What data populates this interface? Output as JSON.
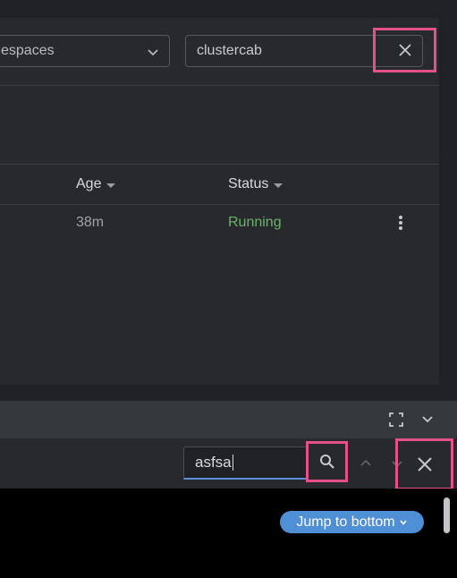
{
  "filters": {
    "namespace_select_value": "espaces",
    "search_value": "clustercab"
  },
  "table": {
    "columns": [
      {
        "label": "Age"
      },
      {
        "label": "Status"
      }
    ],
    "rows": [
      {
        "age": "38m",
        "status": "Running"
      }
    ]
  },
  "log_toolbar": {
    "search_value": "asfsa"
  },
  "log_view": {
    "jump_label": "Jump to bottom"
  },
  "colors": {
    "accent": "#4f8fd6",
    "running": "#6bb36a",
    "highlight": "#e5508a"
  },
  "icons": {
    "clear": "close-icon",
    "select": "chevron-down-icon",
    "fullscreen": "fullscreen-icon",
    "minimize": "chevron-down-icon",
    "search": "search-icon",
    "prev": "chevron-up-icon",
    "next": "chevron-down-icon",
    "close": "close-icon",
    "menu": "more-vertical-icon"
  }
}
